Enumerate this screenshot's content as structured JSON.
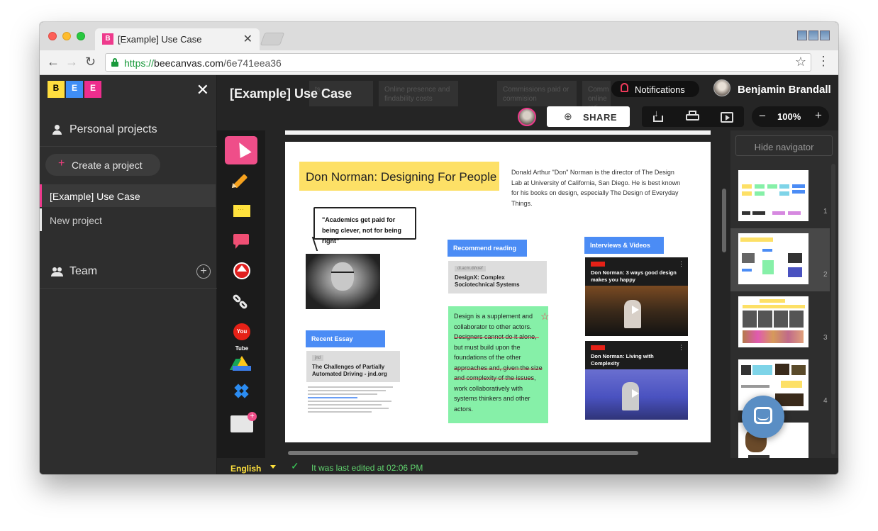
{
  "browser": {
    "tab_title": "[Example] Use Case",
    "tab_favicon": "B",
    "url_scheme": "https://",
    "url_host": "beecanvas.com",
    "url_path": "/6e741eea36",
    "back_icon": "←",
    "forward_icon": "→",
    "reload_icon": "↻",
    "star_icon": "☆",
    "menu_icon": "⋮",
    "close_icon": "✕"
  },
  "sidebar": {
    "logo": [
      "B",
      "E",
      "E"
    ],
    "close_icon": "✕",
    "personal_projects": "Personal projects",
    "create_project": "Create a project",
    "create_plus": "+",
    "projects": [
      {
        "label": "[Example] Use Case",
        "active": true
      },
      {
        "label": "New project",
        "active": false
      }
    ],
    "team": "Team",
    "team_add": "+"
  },
  "header": {
    "doc_title": "[Example] Use Case",
    "notifications": "Notifications",
    "user_name": "Benjamin Brandall",
    "share": "SHARE",
    "share_icon": "⊕",
    "zoom_minus": "−",
    "zoom_value": "100%",
    "zoom_plus": "+",
    "ghost_cards": [
      {
        "text": "ts"
      },
      {
        "text": "Online presence and findability costs"
      },
      {
        "text": "Commissions paid or commision"
      },
      {
        "text": "Comm online rati"
      }
    ]
  },
  "tools": {
    "yt_label": "You Tube",
    "folder_badge": "+"
  },
  "board": {
    "title": "Don Norman: Designing For People",
    "description": "Donald Arthur \"Don\" Norman is the director of The Design Lab at University of California, San Diego. He is best known for his books on design, especially The Design of Everyday Things.",
    "quote": "\"Academics get paid for being clever, not for being right\"",
    "recommend_label": "Recommend reading",
    "recommend_card_src": "dl.acm.dl/xref",
    "recommend_card_title": "DesignX: Complex Sociotechnical Systems",
    "essay_label": "Recent Essay",
    "essay_card_src": "jnd",
    "essay_card_title": "The Challenges of Partially Automated Driving - jnd.org",
    "green_note": "Design is a supplement and collaborator to other actors. Designers cannot do it alone, but must build upon the foundations of the other approaches and, given the size and complexity of the issues, work collaboratively with systems thinkers and other actors.",
    "star_mark": "☆",
    "interviews_label": "Interviews & Videos",
    "video1_title": "Don Norman: 3 ways good design makes you happy",
    "video2_title": "Don Norman: Living with Complexity",
    "kebab": "⋮"
  },
  "navigator": {
    "hide_label": "Hide navigator",
    "pages": [
      "1",
      "2",
      "3",
      "4"
    ]
  },
  "status": {
    "language": "English",
    "check": "✓",
    "last_edited": "It was last edited at 02:06 PM"
  },
  "colors": {
    "accent_pink": "#ee3a8c",
    "sticky_yellow": "#fde066",
    "tag_blue": "#4b8cf5",
    "note_green": "#86f0a8",
    "status_green": "#60d26e",
    "chat_blue": "#5a8ec4"
  }
}
